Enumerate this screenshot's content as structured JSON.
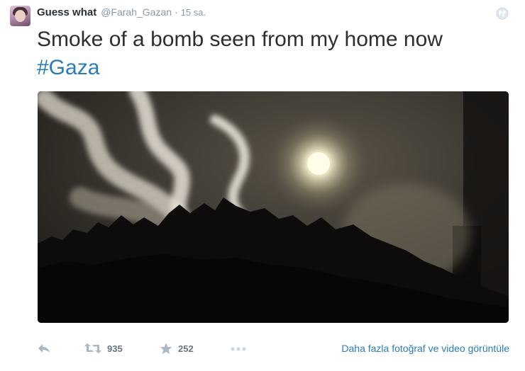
{
  "tweet": {
    "author_name": "Guess what",
    "handle": "@Farah_Gazan",
    "separator": "·",
    "timestamp": "15 sa.",
    "text": "Smoke of a bomb seen from my home now",
    "hashtag": "#Gaza"
  },
  "actions": {
    "retweet_count": "935",
    "favorite_count": "252",
    "more_media_link": "Daha fazla fotoğraf ve video görüntüle"
  },
  "icons": {
    "globe": "globe-icon",
    "reply": "reply-icon",
    "retweet": "retweet-icon",
    "favorite": "star-icon",
    "more": "more-dots-icon"
  },
  "colors": {
    "link": "#2b7bb9",
    "muted": "#8899a6",
    "text": "#292f33"
  }
}
